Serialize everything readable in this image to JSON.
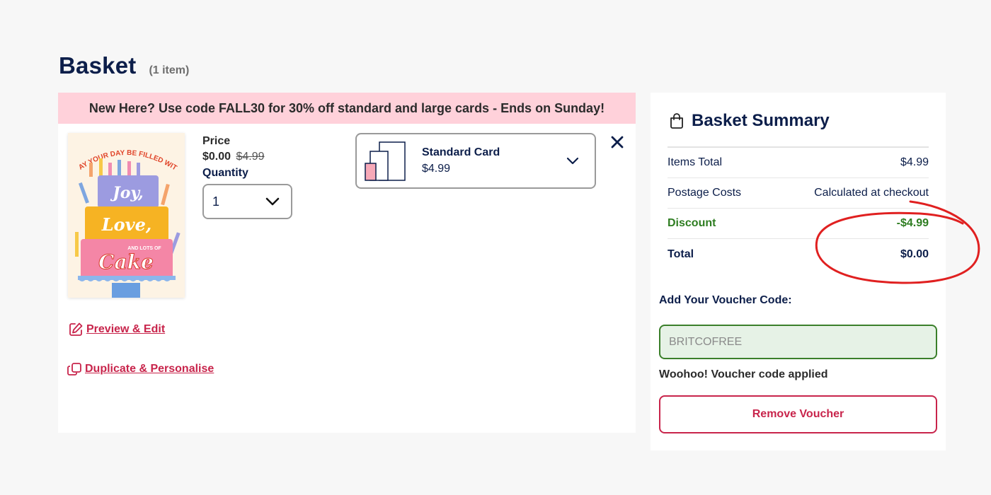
{
  "page": {
    "title": "Basket",
    "item_count": "(1 item)"
  },
  "promo_banner": {
    "text": "New Here? Use code FALL30 for 30% off standard and large cards - Ends on Sunday!"
  },
  "basket_item": {
    "image_alt": "May your day be filled with Joy, Love, and lots of Cake",
    "card_text": {
      "arc": "MAY YOUR DAY BE FILLED WITH",
      "line1": "Joy,",
      "line2": "Love,",
      "small": "AND LOTS OF",
      "line3": "Cake"
    },
    "price_label": "Price",
    "price_current": "$0.00",
    "price_original": "$4.99",
    "quantity_label": "Quantity",
    "quantity_value": "1",
    "size": {
      "name": "Standard Card",
      "price": "$4.99"
    },
    "actions": {
      "preview_edit": "Preview & Edit",
      "duplicate": "Duplicate & Personalise"
    }
  },
  "summary": {
    "title": "Basket Summary",
    "rows": [
      {
        "label": "Items Total",
        "value": "$4.99"
      },
      {
        "label": "Postage Costs",
        "value": "Calculated at checkout"
      },
      {
        "label": "Discount",
        "value": "-$4.99"
      },
      {
        "label": "Total",
        "value": "$0.00"
      }
    ],
    "voucher_label": "Add Your Voucher Code:",
    "voucher_value": "BRITCOFREE",
    "voucher_message": "Woohoo! Voucher code applied",
    "remove_voucher_label": "Remove Voucher"
  },
  "colors": {
    "brand_navy": "#0c1e4a",
    "accent_red": "#c8244b",
    "promo_pink": "#ffd1da",
    "success_green": "#2e7d21",
    "annotation_red": "#e02020"
  }
}
